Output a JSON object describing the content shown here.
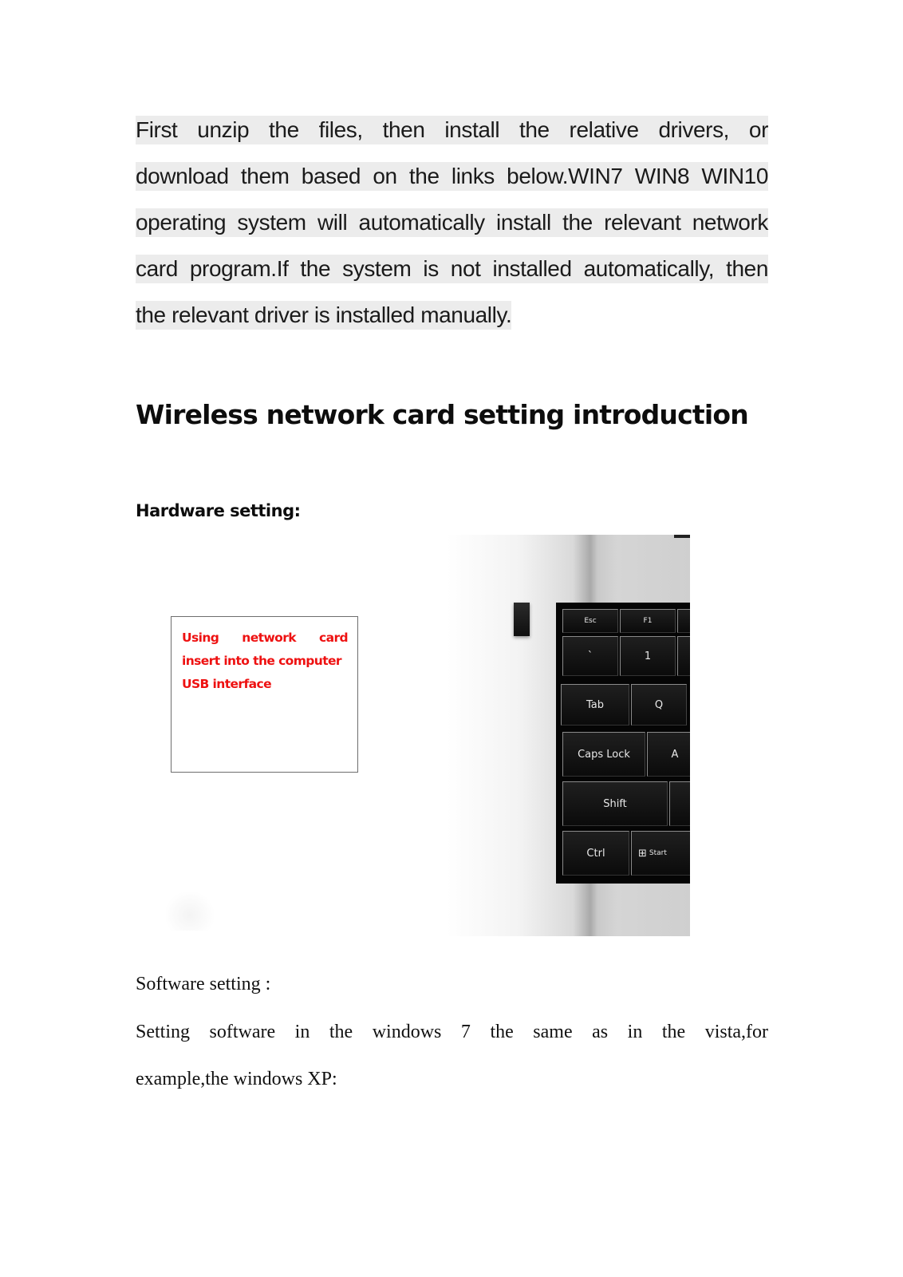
{
  "intro": {
    "lines": [
      "First unzip the files, then install the relative drivers, or",
      "download them based on the links below.WIN7 WIN8 WIN10",
      "operating system will automatically install the relevant network",
      "card program.If the system is not installed automatically, then",
      "the relevant driver is installed manually."
    ]
  },
  "heading": "Wireless network card setting introduction",
  "hardware": {
    "title": "Hardware setting:",
    "callout": {
      "line1": "Using network card",
      "rest": "insert into the computer USB interface",
      "color": "#ee1111"
    },
    "photo": {
      "description": "laptop keyboard with USB wireless network card inserted",
      "keys": [
        "Esc",
        "F1",
        "`",
        "1",
        "Tab",
        "Q",
        "Caps Lock",
        "A",
        "Shift",
        "Ctrl",
        "Start"
      ]
    }
  },
  "software": {
    "title": "Software setting :",
    "line1": "Setting software in the windows 7 the same as in the vista,for",
    "line2": "example,the windows XP:"
  }
}
